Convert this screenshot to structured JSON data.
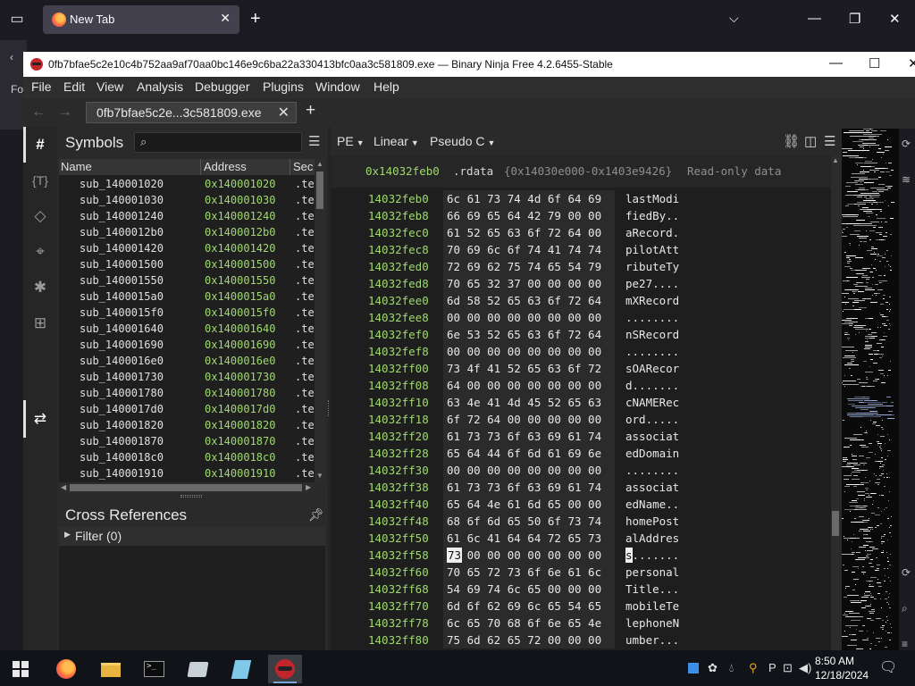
{
  "firefox": {
    "tab_title": "New Tab",
    "strip_text": "Fo"
  },
  "window": {
    "title": "0fb7bfae5c2e10c4b752aa9af70aa0bc146e9c6ba22a330413bfc0aa3c581809.exe — Binary Ninja Free 4.2.6455-Stable"
  },
  "menu": [
    "File",
    "Edit",
    "View",
    "Analysis",
    "Debugger",
    "Plugins",
    "Window",
    "Help"
  ],
  "file_tab": {
    "title": "0fb7bfae5c2e...3c581809.exe"
  },
  "sidebar_icons": [
    "symbols-icon",
    "types-icon",
    "tags-icon",
    "location-icon",
    "debugger-icon",
    "hierarchy-icon",
    "cross-reference-icon"
  ],
  "symbols": {
    "title": "Symbols",
    "search_placeholder": "",
    "columns": [
      "Name",
      "Address",
      "Sec"
    ],
    "rows": [
      {
        "name": "sub_140001020",
        "address": "0x140001020",
        "section": ".te"
      },
      {
        "name": "sub_140001030",
        "address": "0x140001030",
        "section": ".te"
      },
      {
        "name": "sub_140001240",
        "address": "0x140001240",
        "section": ".te"
      },
      {
        "name": "sub_1400012b0",
        "address": "0x1400012b0",
        "section": ".te"
      },
      {
        "name": "sub_140001420",
        "address": "0x140001420",
        "section": ".te"
      },
      {
        "name": "sub_140001500",
        "address": "0x140001500",
        "section": ".te"
      },
      {
        "name": "sub_140001550",
        "address": "0x140001550",
        "section": ".te"
      },
      {
        "name": "sub_1400015a0",
        "address": "0x1400015a0",
        "section": ".te"
      },
      {
        "name": "sub_1400015f0",
        "address": "0x1400015f0",
        "section": ".te"
      },
      {
        "name": "sub_140001640",
        "address": "0x140001640",
        "section": ".te"
      },
      {
        "name": "sub_140001690",
        "address": "0x140001690",
        "section": ".te"
      },
      {
        "name": "sub_1400016e0",
        "address": "0x1400016e0",
        "section": ".te"
      },
      {
        "name": "sub_140001730",
        "address": "0x140001730",
        "section": ".te"
      },
      {
        "name": "sub_140001780",
        "address": "0x140001780",
        "section": ".te"
      },
      {
        "name": "sub_1400017d0",
        "address": "0x1400017d0",
        "section": ".te"
      },
      {
        "name": "sub_140001820",
        "address": "0x140001820",
        "section": ".te"
      },
      {
        "name": "sub_140001870",
        "address": "0x140001870",
        "section": ".te"
      },
      {
        "name": "sub_1400018c0",
        "address": "0x1400018c0",
        "section": ".te"
      },
      {
        "name": "sub_140001910",
        "address": "0x140001910",
        "section": ".te"
      }
    ]
  },
  "cross_references": {
    "title": "Cross References",
    "filter_label": "Filter (0)"
  },
  "hex_toolbar": {
    "view_type": "PE",
    "layout": "Linear",
    "language": "Pseudo C"
  },
  "hex_info": {
    "address": "0x14032feb0",
    "section": ".rdata",
    "range": "{0x14030e000-0x1403e9426}",
    "description": "Read-only data"
  },
  "hex_rows": [
    {
      "addr": "14032feb0",
      "bytes": "6c 61 73 74 4d 6f 64 69",
      "ascii": "lastModi"
    },
    {
      "addr": "14032feb8",
      "bytes": "66 69 65 64 42 79 00 00",
      "ascii": "fiedBy.."
    },
    {
      "addr": "14032fec0",
      "bytes": "61 52 65 63 6f 72 64 00",
      "ascii": "aRecord."
    },
    {
      "addr": "14032fec8",
      "bytes": "70 69 6c 6f 74 41 74 74",
      "ascii": "pilotAtt"
    },
    {
      "addr": "14032fed0",
      "bytes": "72 69 62 75 74 65 54 79",
      "ascii": "ributeTy"
    },
    {
      "addr": "14032fed8",
      "bytes": "70 65 32 37 00 00 00 00",
      "ascii": "pe27...."
    },
    {
      "addr": "14032fee0",
      "bytes": "6d 58 52 65 63 6f 72 64",
      "ascii": "mXRecord"
    },
    {
      "addr": "14032fee8",
      "bytes": "00 00 00 00 00 00 00 00",
      "ascii": "........"
    },
    {
      "addr": "14032fef0",
      "bytes": "6e 53 52 65 63 6f 72 64",
      "ascii": "nSRecord"
    },
    {
      "addr": "14032fef8",
      "bytes": "00 00 00 00 00 00 00 00",
      "ascii": "........"
    },
    {
      "addr": "14032ff00",
      "bytes": "73 4f 41 52 65 63 6f 72",
      "ascii": "sOARecor"
    },
    {
      "addr": "14032ff08",
      "bytes": "64 00 00 00 00 00 00 00",
      "ascii": "d......."
    },
    {
      "addr": "14032ff10",
      "bytes": "63 4e 41 4d 45 52 65 63",
      "ascii": "cNAMERec"
    },
    {
      "addr": "14032ff18",
      "bytes": "6f 72 64 00 00 00 00 00",
      "ascii": "ord....."
    },
    {
      "addr": "14032ff20",
      "bytes": "61 73 73 6f 63 69 61 74",
      "ascii": "associat"
    },
    {
      "addr": "14032ff28",
      "bytes": "65 64 44 6f 6d 61 69 6e",
      "ascii": "edDomain"
    },
    {
      "addr": "14032ff30",
      "bytes": "00 00 00 00 00 00 00 00",
      "ascii": "........"
    },
    {
      "addr": "14032ff38",
      "bytes": "61 73 73 6f 63 69 61 74",
      "ascii": "associat"
    },
    {
      "addr": "14032ff40",
      "bytes": "65 64 4e 61 6d 65 00 00",
      "ascii": "edName.."
    },
    {
      "addr": "14032ff48",
      "bytes": "68 6f 6d 65 50 6f 73 74",
      "ascii": "homePost"
    },
    {
      "addr": "14032ff50",
      "bytes": "61 6c 41 64 64 72 65 73",
      "ascii": "alAddres"
    },
    {
      "addr": "14032ff58",
      "bytes": "73 00 00 00 00 00 00 00",
      "ascii": "s......."
    },
    {
      "addr": "14032ff60",
      "bytes": "70 65 72 73 6f 6e 61 6c",
      "ascii": "personal"
    },
    {
      "addr": "14032ff68",
      "bytes": "54 69 74 6c 65 00 00 00",
      "ascii": "Title..."
    },
    {
      "addr": "14032ff70",
      "bytes": "6d 6f 62 69 6c 65 54 65",
      "ascii": "mobileTe"
    },
    {
      "addr": "14032ff78",
      "bytes": "6c 65 70 68 6f 6e 65 4e",
      "ascii": "lephoneN"
    },
    {
      "addr": "14032ff80",
      "bytes": "75 6d 62 65 72 00 00 00",
      "ascii": "umber..."
    }
  ],
  "hex_cursor": {
    "byte": "73",
    "char": "s"
  },
  "taskbar": {
    "apps": [
      "firefox-icon",
      "file-explorer-icon",
      "terminal-icon",
      "disk-utility-icon",
      "notepad-icon",
      "binary-ninja-icon"
    ],
    "time": "8:50 AM",
    "date": "12/18/2024"
  },
  "colors": {
    "address_green": "#a0d870",
    "background": "#1e1e1e",
    "brand_red": "#c0262c"
  }
}
